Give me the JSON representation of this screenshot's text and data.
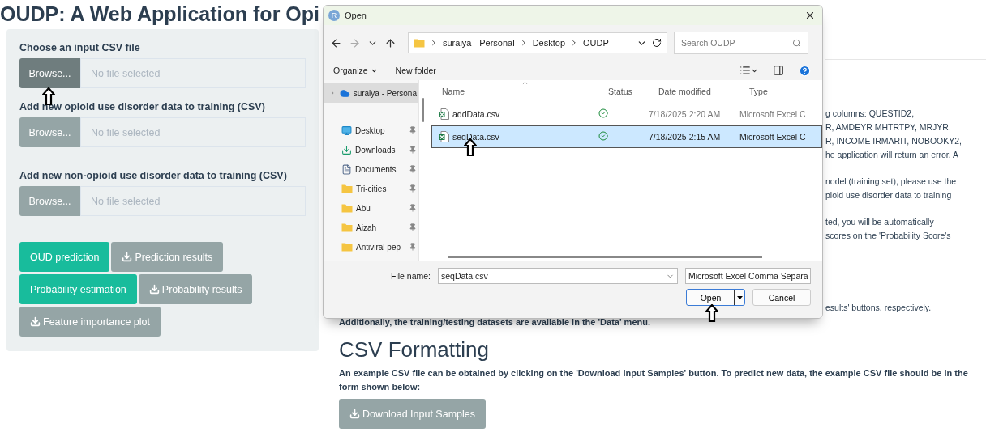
{
  "page": {
    "title": "OUDP: A Web Application for Opi",
    "input_panel": {
      "file_inputs": [
        {
          "label": "Choose an input CSV file",
          "button": "Browse...",
          "placeholder": "No file selected",
          "pressed": true
        },
        {
          "label": "Add new opioid use disorder data to training (CSV)",
          "button": "Browse...",
          "placeholder": "No file selected",
          "pressed": false
        },
        {
          "label": "Add new non-opioid use disorder data to training (CSV)",
          "button": "Browse...",
          "placeholder": "No file selected",
          "pressed": false
        }
      ],
      "action_rows": [
        [
          {
            "label": "OUD prediction",
            "kind": "primary"
          },
          {
            "label": "Prediction results",
            "kind": "download"
          }
        ],
        [
          {
            "label": "Probability estimation",
            "kind": "primary"
          },
          {
            "label": "Probability results",
            "kind": "download"
          }
        ],
        [
          {
            "label": "Feature importance plot",
            "kind": "download"
          }
        ]
      ]
    },
    "content": {
      "fragments": [
        {
          "lines": [
            "g columns: QUESTID2,",
            "R, AMDEYR MHTRTPY, MRJYR,",
            "R, INCOME IRMARIT, NOBOOKY2,",
            "he application will return an error. A"
          ]
        },
        {
          "lines": [
            "nodel (training set), please use the",
            "pioid use disorder data to training"
          ]
        },
        {
          "lines": [
            "ted, you will be automatically",
            "scores on the 'Probability Score's"
          ]
        }
      ],
      "partial_line": "esults' buttons, respectively.",
      "line": "Additionally, the training/testing datasets are available in the 'Data' menu.",
      "heading": "CSV Formatting",
      "paragraph": "An example CSV file can be obtained by clicking on the 'Download Input Samples' button. To predict new data, the example CSV file should be in the form shown below:",
      "download_button": "Download Input Samples"
    }
  },
  "dialog": {
    "title": "Open",
    "avatar": "R",
    "address": [
      "suraiya - Personal",
      "Desktop",
      "OUDP"
    ],
    "search": {
      "placeholder": "Search OUDP"
    },
    "toolbar": [
      "Organize",
      "New folder"
    ],
    "nav_items": [
      {
        "label": "suraiya - Persona",
        "kind": "cloud",
        "selected": true
      },
      {
        "label": "Desktop",
        "kind": "desktop",
        "selected": false
      },
      {
        "label": "Downloads",
        "kind": "downloads",
        "selected": false
      },
      {
        "label": "Documents",
        "kind": "documents",
        "selected": false
      },
      {
        "label": "Tri-cities",
        "kind": "folder",
        "selected": false
      },
      {
        "label": "Abu",
        "kind": "folder",
        "selected": false
      },
      {
        "label": "Aizah",
        "kind": "folder",
        "selected": false
      },
      {
        "label": "Antiviral pep",
        "kind": "folder",
        "selected": false
      }
    ],
    "columns": [
      "Name",
      "Status",
      "Date modified",
      "Type"
    ],
    "files": [
      {
        "name": "addData.csv",
        "date": "7/18/2025 2:20 AM",
        "type": "Microsoft Excel C",
        "selected": false
      },
      {
        "name": "seqData.csv",
        "date": "7/18/2025 2:15 AM",
        "type": "Microsoft Excel C",
        "selected": true
      }
    ],
    "file_name_label": "File name:",
    "file_name": "seqData.csv",
    "file_type": "Microsoft Excel Comma Separa",
    "buttons": [
      {
        "label": "Open",
        "kind": "split"
      },
      {
        "label": "Cancel",
        "kind": "plain"
      }
    ]
  }
}
